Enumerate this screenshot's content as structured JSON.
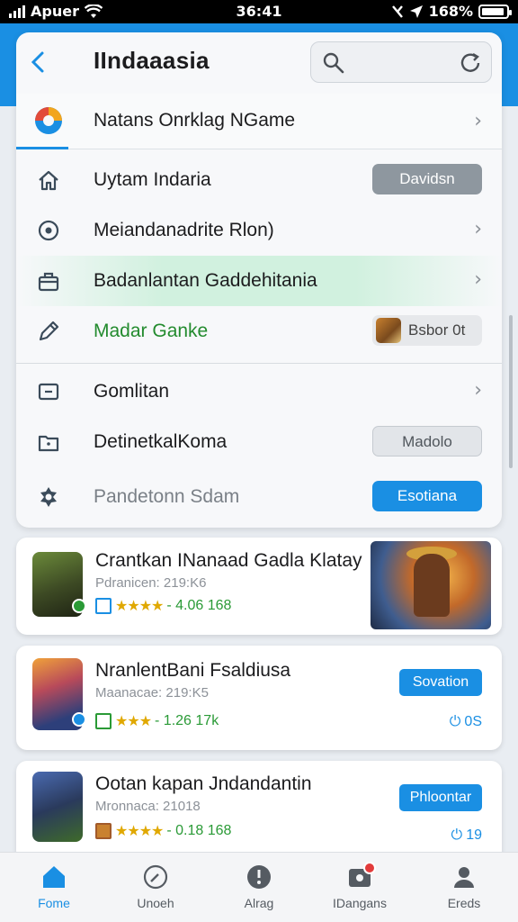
{
  "status_bar": {
    "carrier": "Apuer",
    "time": "36:41",
    "battery": "168%"
  },
  "header": {
    "title": "IIndaaasia",
    "back_icon": "chevron-left-icon",
    "search_icon": "search-icon",
    "refresh_icon": "refresh-icon"
  },
  "tab": {
    "label": "Natans Onrklag NGame"
  },
  "menu": [
    {
      "label": "Uytam Indaria",
      "icon": "home-icon",
      "button": "Davidsn",
      "style": "grey"
    },
    {
      "label": "Meiandanadrite Rlon)",
      "icon": "location-pin-icon",
      "chevron": true
    },
    {
      "label": "Badanlantan Gaddehitania",
      "icon": "briefcase-icon",
      "chevron": true,
      "highlight": true
    },
    {
      "label": "Madar Ganke",
      "icon": "edit-icon",
      "button": "Bsbor 0t",
      "style": "light",
      "color": "green"
    },
    {
      "label": "Gomlitan",
      "icon": "card-icon",
      "chevron": true
    },
    {
      "label": "DetinetkalKoma",
      "icon": "folder-icon",
      "button": "Madolo",
      "style": "outline"
    },
    {
      "label": "Pandetonn Sdam",
      "icon": "settings-gear-icon",
      "button": "Esotiana",
      "style": "blue",
      "muted": true
    }
  ],
  "games": [
    {
      "title": "Crantkan INanaad Gadla Klatay",
      "subtitle": "Pdranicen: 219:K6",
      "stars": "★★★★",
      "rating": "- 4.06 168"
    },
    {
      "title": "NranlentBani Fsaldiusa",
      "subtitle": "Maanacae: 219:K5",
      "stars": "★★★",
      "rating": "- 1.26 17k",
      "button": "Sovation",
      "downloads": "0S"
    },
    {
      "title": "Ootan kapan Jndandantin",
      "subtitle": "Mronnaca: 21018",
      "stars": "★★★★",
      "rating": "- 0.18 168",
      "button": "Phloontar",
      "downloads": "19"
    }
  ],
  "nav": [
    {
      "label": "Fome",
      "icon": "home-icon",
      "active": true
    },
    {
      "label": "Unoeh",
      "icon": "compass-icon"
    },
    {
      "label": "Alrag",
      "icon": "info-icon"
    },
    {
      "label": "IDangans",
      "icon": "games-icon",
      "badge": true
    },
    {
      "label": "Ereds",
      "icon": "profile-icon"
    }
  ],
  "colors": {
    "accent": "#1a8fe3",
    "green": "#238b2e",
    "star": "#e0a800"
  }
}
